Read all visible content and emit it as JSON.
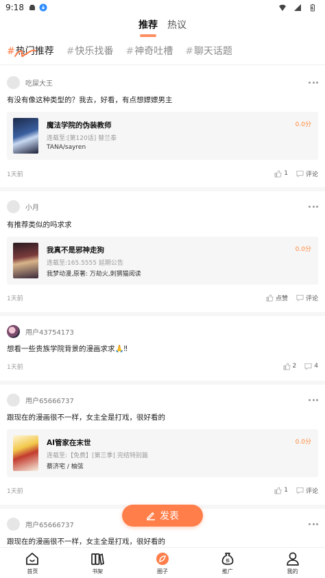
{
  "status_bar": {
    "time": "9:18"
  },
  "top_tabs": [
    {
      "label": "推荐",
      "active": true
    },
    {
      "label": "热议",
      "active": false
    }
  ],
  "topic_tabs": [
    {
      "hash": "#",
      "label": "热门推荐",
      "active": true
    },
    {
      "hash": "#",
      "label": "快乐找番",
      "active": false
    },
    {
      "hash": "#",
      "label": "神奇吐槽",
      "active": false
    },
    {
      "hash": "#",
      "label": "聊天话题",
      "active": false
    }
  ],
  "posts": [
    {
      "author": "吃屎大王",
      "text": "有没有像这种类型的？我去，好看，有点想嫖嫖男主",
      "card": {
        "title": "魔法学院的伪装教师",
        "sub": "连载至:[第120话] 替兰泰",
        "author": "TANA/sayren",
        "score": "0.0分"
      },
      "time": "1天前",
      "likes": "1",
      "comments": "评论"
    },
    {
      "author": "小月",
      "text": "有推荐类似的吗求求",
      "card": {
        "title": "我真不是邪神走狗",
        "sub": "连载至:165.5555 延期公告",
        "author": "我梦动漫,原著: 万劫火,刺猬猫阅读",
        "score": "0.0分"
      },
      "time": "1天前",
      "likes": "点赞",
      "comments": "评论"
    },
    {
      "author": "用户43754173",
      "text": "想看一些贵族学院背景的漫画求求🙏‼",
      "time": "1天前",
      "likes": "2",
      "comments": "4"
    },
    {
      "author": "用户65666737",
      "text": "跟现在的漫画很不一样，女主全是打戏，很好看的",
      "card": {
        "title": "AI管家在末世",
        "sub": "连载至:【免费】[第三季] 完结特别篇",
        "author": "蔡济宅 / 柚弦",
        "score": "0.0分"
      },
      "time": "1天前",
      "likes": "1",
      "comments": "评论"
    },
    {
      "author": "用户65666737",
      "text": "跟现在的漫画很不一样，女主全是打戏，很好看的"
    }
  ],
  "fab": {
    "label": "发表"
  },
  "bottom_nav": [
    {
      "label": "首页",
      "icon": "home-icon"
    },
    {
      "label": "书架",
      "icon": "bookshelf-icon"
    },
    {
      "label": "圈子",
      "icon": "circle-icon",
      "active": true
    },
    {
      "label": "推广",
      "icon": "promote-icon"
    },
    {
      "label": "我的",
      "icon": "profile-icon"
    }
  ],
  "colors": {
    "accent": "#ff7e49",
    "score": "#ff8a3d"
  }
}
